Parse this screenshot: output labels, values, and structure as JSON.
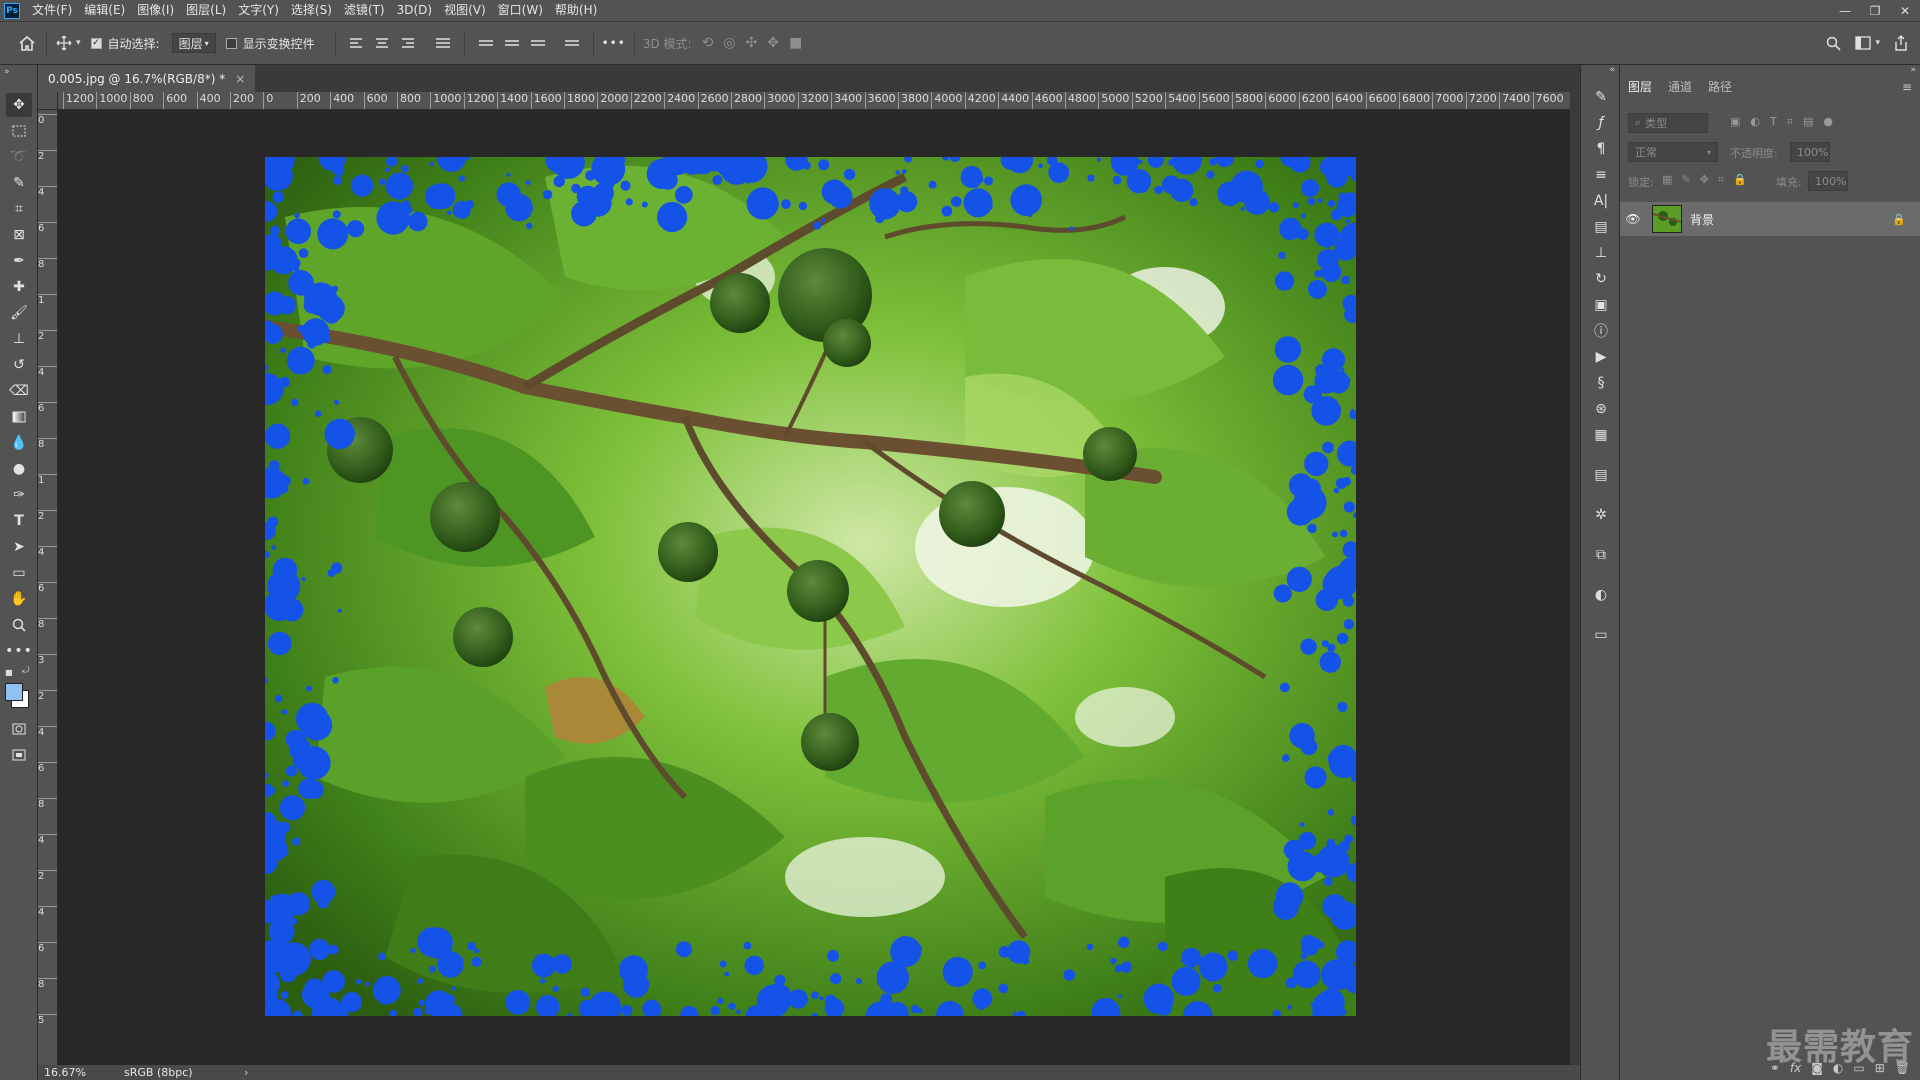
{
  "app": {
    "logo": "Ps"
  },
  "menu": [
    "文件(F)",
    "编辑(E)",
    "图像(I)",
    "图层(L)",
    "文字(Y)",
    "选择(S)",
    "滤镜(T)",
    "3D(D)",
    "视图(V)",
    "窗口(W)",
    "帮助(H)"
  ],
  "window_controls": {
    "minimize": "—",
    "restore": "❐",
    "close": "✕"
  },
  "options": {
    "auto_select_label": "自动选择:",
    "auto_select_checked": true,
    "auto_select_value": "图层",
    "show_transform_label": "显示变换控件",
    "show_transform_checked": false,
    "more_label": "•••",
    "mode_3d_label": "3D 模式:"
  },
  "document": {
    "tab_title": "0.005.jpg @ 16.7%(RGB/8*) *",
    "close_glyph": "×",
    "zoom": "16.67%",
    "color_profile": "sRGB (8bpc)",
    "status_arrow": "›"
  },
  "ruler_h": [
    "1200",
    "1000",
    "800",
    "600",
    "400",
    "200",
    "0",
    "200",
    "400",
    "600",
    "800",
    "1000",
    "1200",
    "1400",
    "1600",
    "1800",
    "2000",
    "2200",
    "2400",
    "2600",
    "2800",
    "3000",
    "3200",
    "3400",
    "3600",
    "3800",
    "4000",
    "4200",
    "4400",
    "4600",
    "4800",
    "5000",
    "5200",
    "5400",
    "5600",
    "5800",
    "6000",
    "6200",
    "6400",
    "6600",
    "6800",
    "7000",
    "7200",
    "7400",
    "7600"
  ],
  "ruler_v": [
    "0",
    "2",
    "4",
    "6",
    "8",
    "1",
    "2",
    "4",
    "6",
    "8",
    "1",
    "2",
    "4",
    "6",
    "8",
    "3",
    "2",
    "4",
    "6",
    "8",
    "4",
    "2",
    "4",
    "6",
    "8",
    "5"
  ],
  "layers_panel": {
    "tabs": [
      "图层",
      "通道",
      "路径"
    ],
    "active_tab": "图层",
    "filter_placeholder": "类型",
    "blend_mode": "正常",
    "opacity_label": "不透明度:",
    "opacity_value": "100%",
    "lock_label": "锁定:",
    "fill_label": "填充:",
    "fill_value": "100%",
    "layers": [
      {
        "name": "背景",
        "visible": true,
        "locked": true
      }
    ],
    "footer_icons": [
      "link-icon",
      "fx-icon",
      "mask-icon",
      "adjustment-icon",
      "group-icon",
      "new-layer-icon",
      "trash-icon"
    ],
    "fx_label": "fx"
  },
  "watermark": "最需教育",
  "colors": {
    "foreground": "#8fc1f2",
    "background": "#ffffff",
    "dot_blue": "#1553e8"
  }
}
